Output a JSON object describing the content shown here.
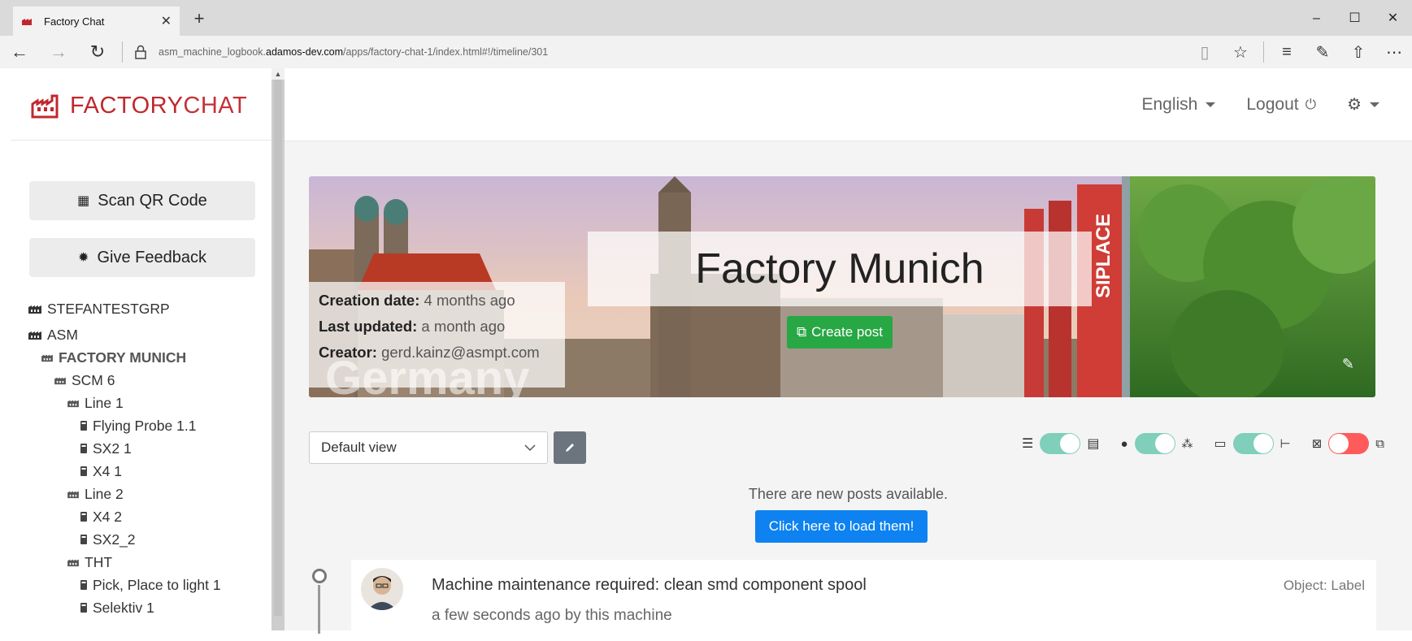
{
  "browser": {
    "tab_title": "Factory Chat",
    "url_prefix": "asm_machine_logbook.",
    "url_domain": "adamos-dev.com",
    "url_path": "/apps/factory-chat-1/index.html#!/timeline/301"
  },
  "sidebar": {
    "logo_bold": "FACTORY",
    "logo_thin": "CHAT",
    "scan_label": "Scan QR Code",
    "feedback_label": "Give Feedback",
    "tree": [
      {
        "label": "STEFANTESTGRP",
        "indent": 0,
        "kind": "group"
      },
      {
        "label": "ASM",
        "indent": 0,
        "kind": "group"
      },
      {
        "label": "FACTORY MUNICH",
        "indent": 1,
        "kind": "factory"
      },
      {
        "label": "SCM 6",
        "indent": 2,
        "kind": "factory"
      },
      {
        "label": "Line 1",
        "indent": 3,
        "kind": "factory"
      },
      {
        "label": "Flying Probe 1.1",
        "indent": 4,
        "kind": "machine"
      },
      {
        "label": "SX2 1",
        "indent": 4,
        "kind": "machine"
      },
      {
        "label": "X4 1",
        "indent": 4,
        "kind": "machine"
      },
      {
        "label": "Line 2",
        "indent": 3,
        "kind": "factory"
      },
      {
        "label": "X4 2",
        "indent": 4,
        "kind": "machine"
      },
      {
        "label": "SX2_2",
        "indent": 4,
        "kind": "machine"
      },
      {
        "label": "THT",
        "indent": 3,
        "kind": "factory"
      },
      {
        "label": "Pick, Place to light 1",
        "indent": 4,
        "kind": "machine"
      },
      {
        "label": "Selektiv 1",
        "indent": 4,
        "kind": "machine"
      }
    ]
  },
  "header": {
    "language": "English",
    "logout": "Logout"
  },
  "banner": {
    "title": "Factory Munich",
    "creation_label": "Creation date:",
    "creation_value": "4 months ago",
    "updated_label": "Last updated:",
    "updated_value": "a month ago",
    "creator_label": "Creator:",
    "creator_value": "gerd.kainz@asmpt.com",
    "watermark": "Germany",
    "flag_text": "SIPLACE",
    "create_post": "Create post"
  },
  "view": {
    "selected": "Default view"
  },
  "toggles": [
    {
      "name": "list-vs-posts",
      "state": "on"
    },
    {
      "name": "user-vs-group",
      "state": "on"
    },
    {
      "name": "folder-vs-tree",
      "state": "on"
    },
    {
      "name": "hide-vs-show-comments",
      "state": "off"
    }
  ],
  "notice": {
    "text": "There are new posts available.",
    "button": "Click here to load them!"
  },
  "post": {
    "title": "Machine maintenance required: clean smd component spool",
    "meta": "a few seconds ago by this machine",
    "object": "Object: Label"
  },
  "colors": {
    "brand": "#c0282d",
    "create_post": "#28a745",
    "load_button": "#0d82f0",
    "toggle_on": "#7fcfba",
    "toggle_off": "#ff5b5b"
  }
}
